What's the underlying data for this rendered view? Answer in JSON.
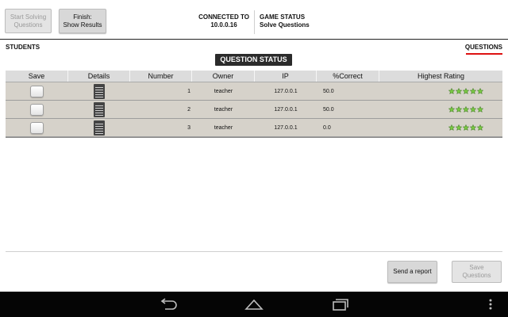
{
  "toolbar": {
    "start_label": "Start Solving\nQuestions",
    "finish_label": "Finish:\nShow Results"
  },
  "connection": {
    "label": "CONNECTED TO",
    "address": "10.0.0.16"
  },
  "game_status": {
    "label": "GAME STATUS",
    "value": "Solve Questions"
  },
  "tabs": {
    "students": "STUDENTS",
    "questions": "QUESTIONS"
  },
  "section_title": "QUESTION STATUS",
  "table": {
    "headers": [
      "Save",
      "Details",
      "Number",
      "Owner",
      "IP",
      "%Correct",
      "Highest Rating"
    ],
    "rows": [
      {
        "number": "1",
        "owner": "teacher",
        "ip": "127.0.0.1",
        "correct": "50.0",
        "rating": 5
      },
      {
        "number": "2",
        "owner": "teacher",
        "ip": "127.0.0.1",
        "correct": "50.0",
        "rating": 5
      },
      {
        "number": "3",
        "owner": "teacher",
        "ip": "127.0.0.1",
        "correct": "0.0",
        "rating": 5
      }
    ]
  },
  "actions": {
    "send_report": "Send a report",
    "save_questions": "Save\nQuestions"
  },
  "colors": {
    "accent_underline": "#dd1111",
    "star_fill": "#7ac943",
    "row_bg": "#d6d2ca"
  },
  "icons": {
    "details": "notepad-icon",
    "rating": "star-icon",
    "nav_back": "back-arrow-icon",
    "nav_home": "home-icon",
    "nav_recents": "recent-apps-icon",
    "nav_menu": "overflow-menu-icon"
  }
}
